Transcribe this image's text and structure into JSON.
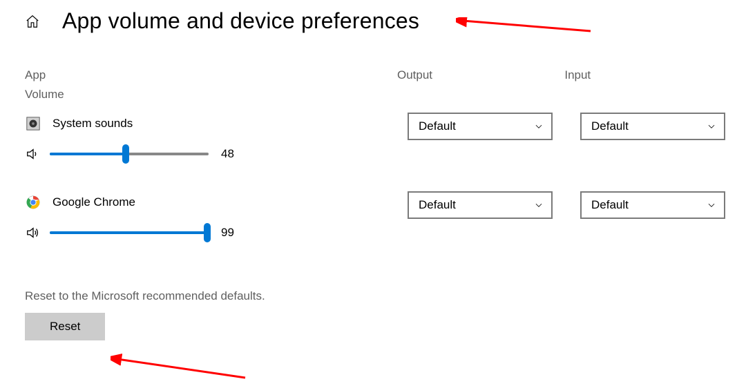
{
  "header": {
    "title": "App volume and device preferences"
  },
  "columns": {
    "app": "App",
    "output": "Output",
    "input": "Input"
  },
  "volume_label": "Volume",
  "apps": [
    {
      "name": "System sounds",
      "volume": 48,
      "output": "Default",
      "input": "Default",
      "icon": "system-sounds-icon"
    },
    {
      "name": "Google Chrome",
      "volume": 99,
      "output": "Default",
      "input": "Default",
      "icon": "chrome-icon"
    }
  ],
  "reset": {
    "description": "Reset to the Microsoft recommended defaults.",
    "button_label": "Reset"
  }
}
